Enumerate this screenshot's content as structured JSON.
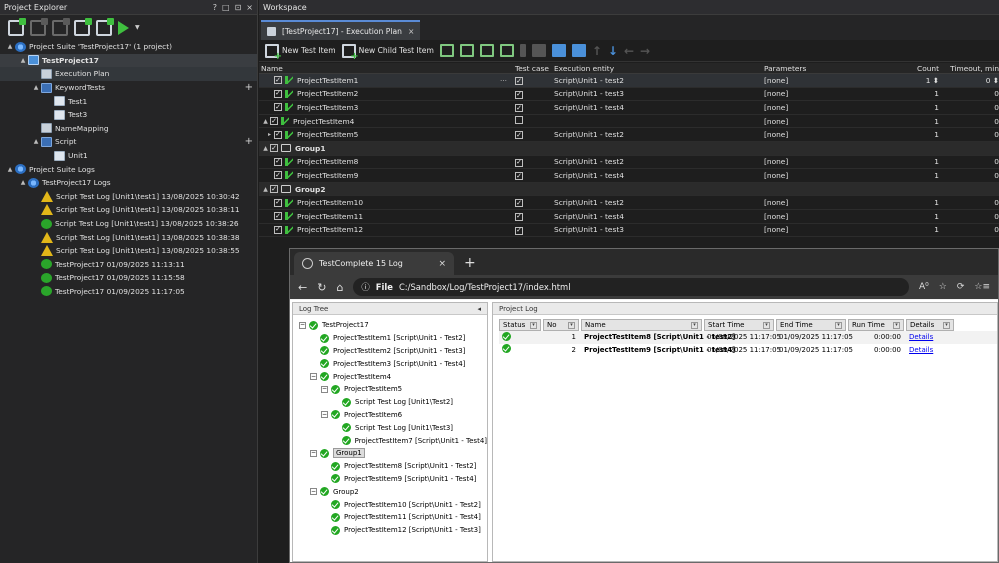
{
  "project_explorer": {
    "title": "Project Explorer",
    "ctrls": [
      "?",
      "□",
      "⊡",
      "×"
    ],
    "tree": [
      {
        "label": "Project Suite 'TestProject17' (1 project)",
        "level": 0,
        "icon": "suite",
        "exp": "▲"
      },
      {
        "label": "TestProject17",
        "level": 1,
        "icon": "project",
        "exp": "▲",
        "bold": true,
        "selected": true
      },
      {
        "label": "Execution Plan",
        "level": 2,
        "icon": "plan",
        "exp": "",
        "highlight": true
      },
      {
        "label": "KeywordTests",
        "level": 2,
        "icon": "folder",
        "exp": "▲",
        "plus": true
      },
      {
        "label": "Test1",
        "level": 3,
        "icon": "doc",
        "exp": ""
      },
      {
        "label": "Test3",
        "level": 3,
        "icon": "doc",
        "exp": ""
      },
      {
        "label": "NameMapping",
        "level": 2,
        "icon": "plan",
        "exp": ""
      },
      {
        "label": "Script",
        "level": 2,
        "icon": "folder",
        "exp": "▲",
        "plus": true
      },
      {
        "label": "Unit1",
        "level": 3,
        "icon": "doc",
        "exp": ""
      },
      {
        "label": "Project Suite Logs",
        "level": 0,
        "icon": "suite",
        "exp": "▲"
      },
      {
        "label": "TestProject17 Logs",
        "level": 1,
        "icon": "suite",
        "exp": "▲"
      },
      {
        "label": "Script Test Log [Unit1\\test1] 13/08/2025 10:30:42",
        "level": 2,
        "icon": "logwarn",
        "exp": ""
      },
      {
        "label": "Script Test Log [Unit1\\test1] 13/08/2025 10:38:11",
        "level": 2,
        "icon": "logwarn",
        "exp": ""
      },
      {
        "label": "Script Test Log [Unit1\\test1] 13/08/2025 10:38:26",
        "level": 2,
        "icon": "logok",
        "exp": ""
      },
      {
        "label": "Script Test Log [Unit1\\test1] 13/08/2025 10:38:38",
        "level": 2,
        "icon": "logwarn",
        "exp": ""
      },
      {
        "label": "Script Test Log [Unit1\\test1] 13/08/2025 10:38:55",
        "level": 2,
        "icon": "logwarn",
        "exp": ""
      },
      {
        "label": "TestProject17 01/09/2025 11:13:11",
        "level": 2,
        "icon": "logok",
        "exp": ""
      },
      {
        "label": "TestProject17 01/09/2025 11:15:58",
        "level": 2,
        "icon": "logok",
        "exp": ""
      },
      {
        "label": "TestProject17 01/09/2025 11:17:05",
        "level": 2,
        "icon": "logok",
        "exp": ""
      }
    ]
  },
  "workspace": {
    "title": "Workspace",
    "tab_label": "[TestProject17] - Execution Plan",
    "tab_close": "×",
    "toolbar": {
      "new_test_item": "New Test Item",
      "new_child_test_item": "New Child Test Item"
    },
    "columns": {
      "name": "Name",
      "test_case": "Test case",
      "execution_entity": "Execution entity",
      "parameters": "Parameters",
      "count": "Count",
      "timeout": "Timeout, min"
    },
    "rows": [
      {
        "name": "ProjectTestItem1",
        "indent": 1,
        "arrow": "",
        "checked": true,
        "group": false,
        "tc": true,
        "entity": "Script\\Unit1 - test2",
        "params": "[none]",
        "count": "1 ⬍",
        "timeout": "0 ⬍",
        "selected": true,
        "ellipsis": "···"
      },
      {
        "name": "ProjectTestItem2",
        "indent": 1,
        "arrow": "",
        "checked": true,
        "group": false,
        "tc": true,
        "entity": "Script\\Unit1 - test3",
        "params": "[none]",
        "count": "1",
        "timeout": "0"
      },
      {
        "name": "ProjectTestItem3",
        "indent": 1,
        "arrow": "",
        "checked": true,
        "group": false,
        "tc": true,
        "entity": "Script\\Unit1 - test4",
        "params": "[none]",
        "count": "1",
        "timeout": "0"
      },
      {
        "name": "ProjectTestItem4",
        "indent": 0,
        "arrow": "▲",
        "checked": true,
        "group": false,
        "tc": false,
        "entity": "",
        "params": "[none]",
        "count": "1",
        "timeout": "0"
      },
      {
        "name": "ProjectTestItem5",
        "indent": 1,
        "arrow": "▸",
        "checked": true,
        "group": false,
        "tc": true,
        "entity": "Script\\Unit1 - test2",
        "params": "[none]",
        "count": "1",
        "timeout": "0"
      },
      {
        "name": "Group1",
        "indent": 0,
        "arrow": "▲",
        "checked": true,
        "group": true,
        "tc": null,
        "entity": "",
        "params": "",
        "count": "",
        "timeout": ""
      },
      {
        "name": "ProjectTestItem8",
        "indent": 1,
        "arrow": "",
        "checked": true,
        "group": false,
        "tc": true,
        "entity": "Script\\Unit1 - test2",
        "params": "[none]",
        "count": "1",
        "timeout": "0"
      },
      {
        "name": "ProjectTestItem9",
        "indent": 1,
        "arrow": "",
        "checked": true,
        "group": false,
        "tc": true,
        "entity": "Script\\Unit1 - test4",
        "params": "[none]",
        "count": "1",
        "timeout": "0"
      },
      {
        "name": "Group2",
        "indent": 0,
        "arrow": "▲",
        "checked": true,
        "group": true,
        "tc": null,
        "entity": "",
        "params": "",
        "count": "",
        "timeout": ""
      },
      {
        "name": "ProjectTestItem10",
        "indent": 1,
        "arrow": "",
        "checked": true,
        "group": false,
        "tc": true,
        "entity": "Script\\Unit1 - test2",
        "params": "[none]",
        "count": "1",
        "timeout": "0"
      },
      {
        "name": "ProjectTestItem11",
        "indent": 1,
        "arrow": "",
        "checked": true,
        "group": false,
        "tc": true,
        "entity": "Script\\Unit1 - test4",
        "params": "[none]",
        "count": "1",
        "timeout": "0"
      },
      {
        "name": "ProjectTestItem12",
        "indent": 1,
        "arrow": "",
        "checked": true,
        "group": false,
        "tc": true,
        "entity": "Script\\Unit1 - test3",
        "params": "[none]",
        "count": "1",
        "timeout": "0"
      }
    ]
  },
  "browser": {
    "tab_title": "TestComplete 15 Log",
    "tab_close": "×",
    "new_tab": "+",
    "nav": {
      "back": "←",
      "reload": "↻",
      "home": "⌂",
      "info": "ⓘ"
    },
    "url_scheme": "File",
    "url": "C:/Sandbox/Log/TestProject17/index.html",
    "right_icons": [
      "A⁰",
      "☆",
      "⟳",
      "☆≡"
    ],
    "log_tree": {
      "title": "Log Tree",
      "collapse": "◂",
      "items": [
        {
          "label": "TestProject17",
          "level": 0,
          "box": "−"
        },
        {
          "label": "ProjectTestItem1 [Script\\Unit1 - Test2]",
          "level": 1,
          "box": ""
        },
        {
          "label": "ProjectTestItem2 [Script\\Unit1 - Test3]",
          "level": 1,
          "box": ""
        },
        {
          "label": "ProjectTestItem3 [Script\\Unit1 - Test4]",
          "level": 1,
          "box": ""
        },
        {
          "label": "ProjectTestItem4",
          "level": 1,
          "box": "−"
        },
        {
          "label": "ProjectTestItem5",
          "level": 2,
          "box": "−"
        },
        {
          "label": "Script Test Log [Unit1\\Test2]",
          "level": 3,
          "box": ""
        },
        {
          "label": "ProjectTestItem6",
          "level": 2,
          "box": "−"
        },
        {
          "label": "Script Test Log [Unit1\\Test3]",
          "level": 3,
          "box": ""
        },
        {
          "label": "ProjectTestItem7 [Script\\Unit1 - Test4]",
          "level": 3,
          "box": ""
        },
        {
          "label": "Group1",
          "level": 1,
          "box": "−",
          "boxed": true
        },
        {
          "label": "ProjectTestItem8 [Script\\Unit1 - Test2]",
          "level": 2,
          "box": ""
        },
        {
          "label": "ProjectTestItem9 [Script\\Unit1 - Test4]",
          "level": 2,
          "box": ""
        },
        {
          "label": "Group2",
          "level": 1,
          "box": "−"
        },
        {
          "label": "ProjectTestItem10 [Script\\Unit1 - Test2]",
          "level": 2,
          "box": ""
        },
        {
          "label": "ProjectTestItem11 [Script\\Unit1 - Test4]",
          "level": 2,
          "box": ""
        },
        {
          "label": "ProjectTestItem12 [Script\\Unit1 - Test3]",
          "level": 2,
          "box": ""
        }
      ]
    },
    "project_log": {
      "title": "Project Log",
      "headers": {
        "status": "Status",
        "no": "No",
        "name": "Name",
        "start": "Start Time",
        "end": "End Time",
        "run": "Run Time",
        "details": "Details"
      },
      "sort_glyph": "▾",
      "rows": [
        {
          "no": "1",
          "name": "ProjectTestItem8 [Script\\Unit1 - test2]",
          "start": "01/09/2025 11:17:05",
          "end": "01/09/2025 11:17:05",
          "run": "0:00:00",
          "details": "Details"
        },
        {
          "no": "2",
          "name": "ProjectTestItem9 [Script\\Unit1 - test4]",
          "start": "01/09/2025 11:17:05",
          "end": "01/09/2025 11:17:05",
          "run": "0:00:00",
          "details": "Details"
        }
      ]
    }
  },
  "colors": {
    "accent": "#5a8bd6",
    "ok": "#22a722",
    "warn": "#e2b719",
    "dark_bg": "#1e1e1e"
  }
}
